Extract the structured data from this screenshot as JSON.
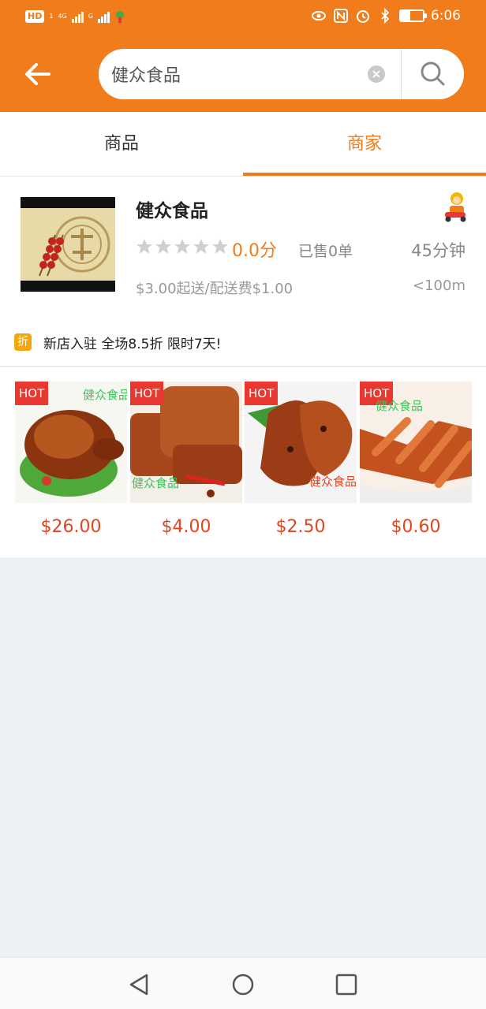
{
  "status_bar": {
    "hd_label": "HD",
    "sim_label": "1",
    "network_label": "4G",
    "network2_label": "G",
    "time": "6:06",
    "battery_level": 0.45
  },
  "header": {
    "search_value": "健众食品"
  },
  "tabs": [
    {
      "label": "商品",
      "active": false
    },
    {
      "label": "商家",
      "active": true
    }
  ],
  "shop": {
    "name": "健众食品",
    "rating": "0.0分",
    "stars_filled": 0,
    "sold": "已售0单",
    "time": "45分钟",
    "delivery": "$3.00起送/配送费$1.00",
    "distance": "<100m",
    "promo_badge": "折",
    "promo_text": "新店入驻 全场8.5折 限时7天!"
  },
  "products": [
    {
      "badge": "HOT",
      "watermark": "健众食品",
      "price": "$26.00"
    },
    {
      "badge": "HOT",
      "watermark": "健众食品",
      "price": "$4.00"
    },
    {
      "badge": "HOT",
      "watermark": "健众食品",
      "price": "$2.50"
    },
    {
      "badge": "HOT",
      "watermark": "健众食品",
      "price": "$0.60"
    }
  ],
  "colors": {
    "brand": "#f07c1c",
    "price": "#e0461f",
    "hot_badge": "#e8382f",
    "background": "#edf0f3"
  },
  "icons": [
    "back-arrow-icon",
    "clear-icon",
    "search-icon",
    "star-icon",
    "courier-icon",
    "back-nav-icon",
    "home-nav-icon",
    "recents-nav-icon"
  ]
}
